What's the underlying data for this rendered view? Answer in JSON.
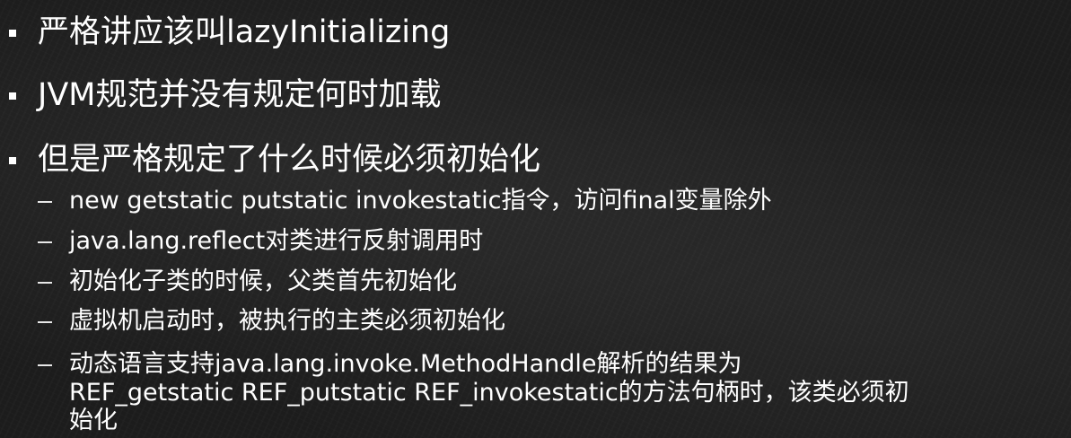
{
  "bullets": [
    {
      "text": "严格讲应该叫lazyInitializing"
    },
    {
      "text": "JVM规范并没有规定何时加载"
    },
    {
      "text": "但是严格规定了什么时候必须初始化"
    }
  ],
  "sub_bullets": [
    {
      "text": "new getstatic putstatic invokestatic指令，访问final变量除外"
    },
    {
      "text": "java.lang.reflect对类进行反射调用时"
    },
    {
      "text": "初始化子类的时候，父类首先初始化"
    },
    {
      "text": "虚拟机启动时，被执行的主类必须初始化"
    },
    {
      "line1": "动态语言支持java.lang.invoke.MethodHandle解析的结果为",
      "line2": "REF_getstatic REF_putstatic REF_invokestatic的方法句柄时，该类必须初",
      "line3": "始化"
    }
  ]
}
